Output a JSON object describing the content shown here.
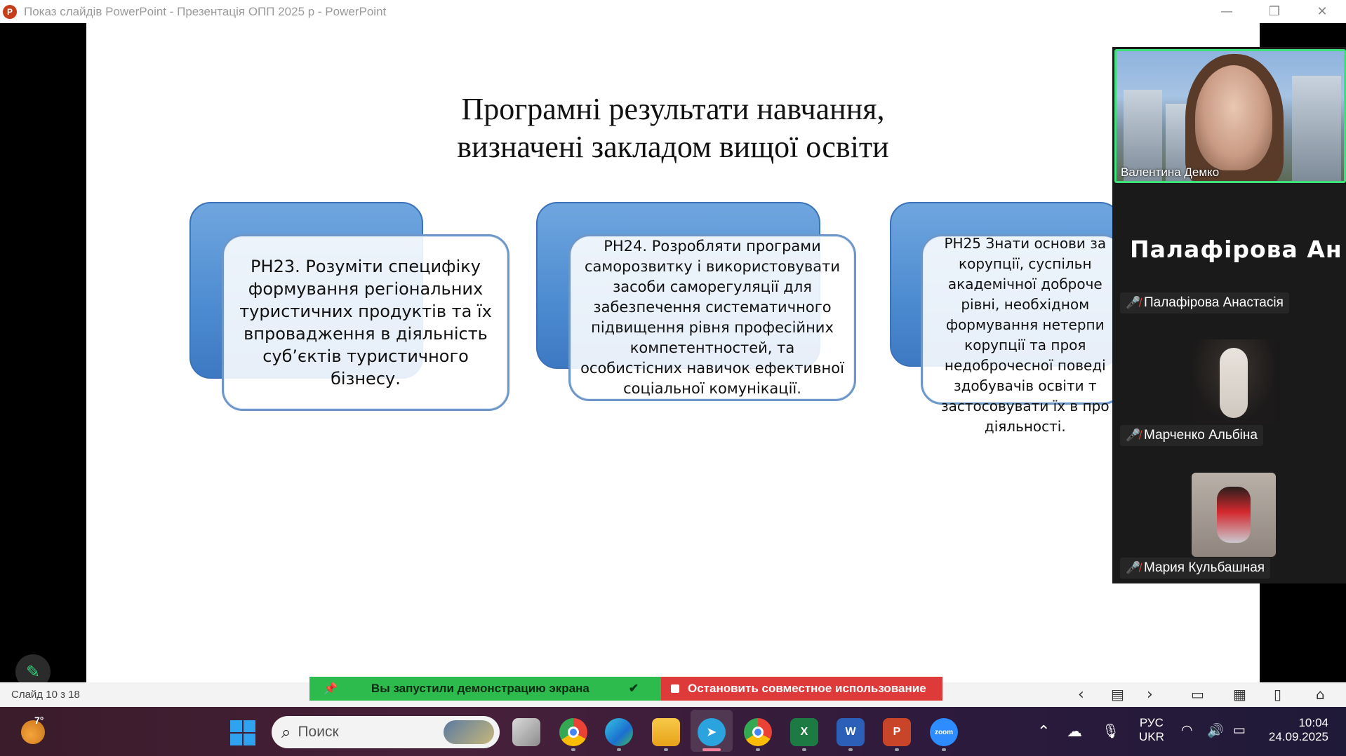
{
  "window": {
    "app_icon": "P",
    "title": "Показ слайдів PowerPoint  -  Презентація ОПП 2025 р  -  PowerPoint",
    "minimize": "—",
    "restore": "❐",
    "close": "✕"
  },
  "slide": {
    "title_line1": "Програмні результати навчання,",
    "title_line2": "визначені закладом вищої освіти",
    "cards": [
      "РН23. Розуміти специфіку\nформування регіональних\nтуристичних продуктів та їх\nвпровадження в діяльність\nсуб’єктів туристичного\nбізнесу.",
      "РН24. Розробляти програми\nсаморозвитку і використовувати\nзасоби саморегуляції для\nзабезпечення систематичного\nпідвищення рівня професійних\nкомпетентностей, та\nособистісних навичок ефективної\nсоціальної комунікації.",
      "РН25 Знати основи за\nкорупції, суспільн\nакадемічної доброче\nрівні, необхідном\nформування нетерпи\nкорупції та проя\nнедоброчесної поведі\nздобувачів освіти т\nзастосовувати їх в про\nдіяльності."
    ]
  },
  "zoom": {
    "active_speaker": "Валентина Демко",
    "big_name": "Палафірова Ан...",
    "participants": [
      {
        "name": "Палафірова Анастасія",
        "muted": true
      },
      {
        "name": "Марченко Альбіна",
        "muted": true
      },
      {
        "name": "Мария Кульбашная",
        "muted": true
      }
    ],
    "share_notice": "Вы запустили демонстрацию экрана",
    "stop_share": "Остановить совместное использование"
  },
  "statusbar": {
    "slide_counter": "Слайд 10 з 18"
  },
  "taskbar": {
    "weather_temp": "7°",
    "search_placeholder": "Поиск",
    "lang_line1": "РУС",
    "lang_line2": "UKR",
    "time": "10:04",
    "date": "24.09.2025"
  },
  "colors": {
    "share_green": "#2dbb4e",
    "share_red": "#de3a3a",
    "card_blue": "#4d8bd0",
    "speaker_border": "#3ee07a"
  }
}
